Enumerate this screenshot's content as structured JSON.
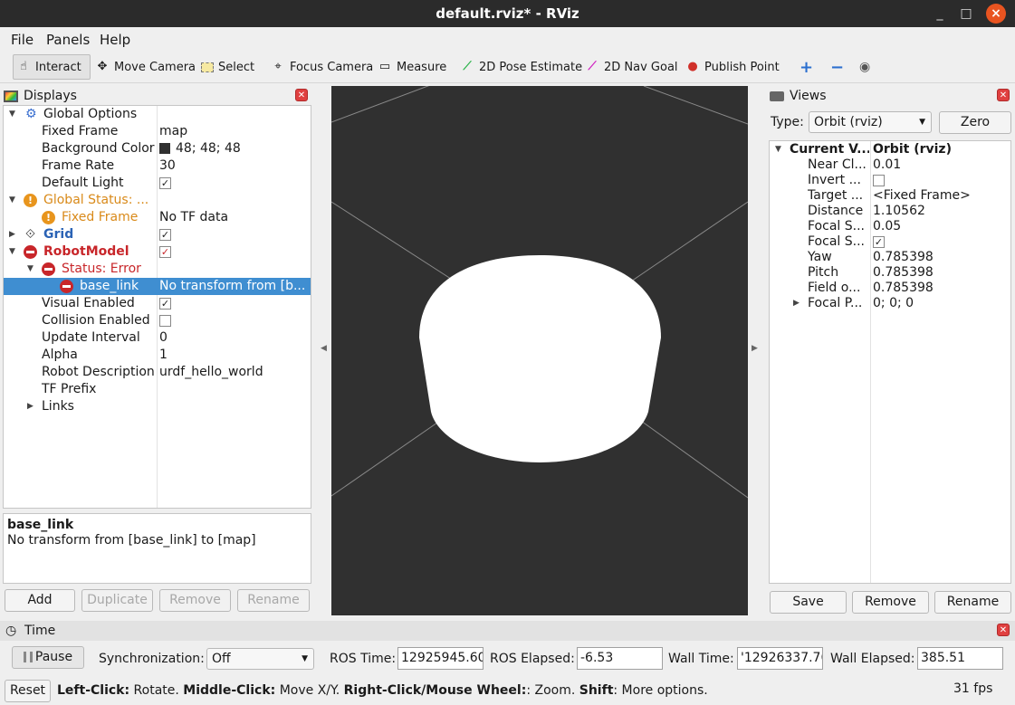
{
  "window": {
    "title": "default.rviz* - RViz",
    "minimize": "_",
    "maximize": "□",
    "close": "×"
  },
  "menu": [
    "File",
    "Panels",
    "Help"
  ],
  "toolbar": {
    "interact": "Interact",
    "move_camera": "Move Camera",
    "select": "Select",
    "focus_camera": "Focus Camera",
    "measure": "Measure",
    "pose_estimate": "2D Pose Estimate",
    "nav_goal": "2D Nav Goal",
    "publish_point": "Publish Point"
  },
  "displays": {
    "title": "Displays",
    "rows": {
      "global_options": "Global Options",
      "fixed_frame": "Fixed Frame",
      "fixed_frame_val": "map",
      "bg_color": "Background Color",
      "bg_color_val": "48; 48; 48",
      "frame_rate": "Frame Rate",
      "frame_rate_val": "30",
      "default_light": "Default Light",
      "global_status": "Global Status: ...",
      "gs_fixed_frame": "Fixed Frame",
      "gs_fixed_frame_val": "No TF data",
      "grid": "Grid",
      "robot_model": "RobotModel",
      "status_error": "Status: Error",
      "base_link": "base_link",
      "base_link_val": "No transform from [b...",
      "visual_enabled": "Visual Enabled",
      "collision_enabled": "Collision Enabled",
      "update_interval": "Update Interval",
      "update_interval_val": "0",
      "alpha": "Alpha",
      "alpha_val": "1",
      "robot_description": "Robot Description",
      "robot_description_val": "urdf_hello_world",
      "tf_prefix": "TF Prefix",
      "links": "Links"
    },
    "desc_title": "base_link",
    "desc_text": "No transform from [base_link] to [map]",
    "buttons": {
      "add": "Add",
      "duplicate": "Duplicate",
      "remove": "Remove",
      "rename": "Rename"
    }
  },
  "views": {
    "title": "Views",
    "type_label": "Type:",
    "type_value": "Orbit (rviz)",
    "zero": "Zero",
    "rows": {
      "current_view": "Current V...",
      "current_view_val": "Orbit (rviz)",
      "near_clip": "Near Cl...",
      "near_clip_val": "0.01",
      "invert": "Invert ...",
      "target": "Target ...",
      "target_val": "<Fixed Frame>",
      "distance": "Distance",
      "distance_val": "1.10562",
      "focal_s1": "Focal S...",
      "focal_s1_val": "0.05",
      "focal_s2": "Focal S...",
      "yaw": "Yaw",
      "yaw_val": "0.785398",
      "pitch": "Pitch",
      "pitch_val": "0.785398",
      "field": "Field o...",
      "field_val": "0.785398",
      "focal_p": "Focal P...",
      "focal_p_val": "0; 0; 0"
    },
    "buttons": {
      "save": "Save",
      "remove": "Remove",
      "rename": "Rename"
    }
  },
  "time": {
    "title": "Time",
    "pause": "Pause",
    "sync_label": "Synchronization:",
    "sync_value": "Off",
    "ros_time_label": "ROS Time:",
    "ros_time": "12925945.60",
    "ros_elapsed_label": "ROS Elapsed:",
    "ros_elapsed": "-6.53",
    "wall_time_label": "Wall Time:",
    "wall_time": "'12926337.76",
    "wall_elapsed_label": "Wall Elapsed:",
    "wall_elapsed": "385.51"
  },
  "status": {
    "reset": "Reset",
    "k1": "Left-Click:",
    "v1": " Rotate. ",
    "k2": "Middle-Click:",
    "v2": " Move X/Y. ",
    "k3": "Right-Click/Mouse Wheel:",
    "v3": ": Zoom. ",
    "k4": "Shift",
    "v4": ": More options.",
    "fps": "31 fps"
  },
  "colors": {
    "background": "#303030",
    "swatch": "#303030",
    "selection": "#3f8ed1",
    "error": "#c8262a",
    "warning": "#e8951d"
  }
}
